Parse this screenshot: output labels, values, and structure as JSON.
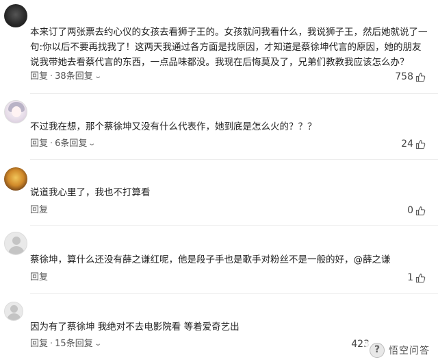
{
  "comments": [
    {
      "text": "本来订了两张票去约心仪的女孩去看狮子王的。女孩就问我看什么，我说狮子王，然后她就说了一句:你以后不要再找我了！这两天我通过各方面是找原因，才知道是蔡徐坤代言的原因，她的朋友说我带她去看蔡代言的东西，一点品味都没。我现在后悔莫及了，兄弟们教教我应该怎么办？",
      "reply_label": "回复",
      "sep": "·",
      "replies_label": "38条回复",
      "likes": "758",
      "avatar": "dark"
    },
    {
      "text": "不过我在想，那个蔡徐坤又没有什么代表作，她到底是怎么火的？？？",
      "reply_label": "回复",
      "sep": "·",
      "replies_label": "6条回复",
      "likes": "24",
      "avatar": "anime"
    },
    {
      "text": "说道我心里了，我也不打算看",
      "reply_label": "回复",
      "likes": "0",
      "avatar": "pizza"
    },
    {
      "text": "蔡徐坤，算什么还没有薛之谦红呢，他是段子手也是歌手对粉丝不是一般的好，@薛之谦",
      "reply_label": "回复",
      "likes": "1",
      "avatar": "gray"
    },
    {
      "text": "因为有了蔡徐坤 我绝对不去电影院看 等着爱奇艺出",
      "reply_label": "回复",
      "sep": "·",
      "replies_label": "15条回复",
      "likes": "423",
      "avatar": "gray"
    }
  ],
  "watermark": {
    "text": "悟空问答",
    "icon": "wukong-logo-icon"
  },
  "colors": {
    "text": "#222222",
    "meta": "#555555",
    "divider": "#ececec"
  },
  "icons": {
    "like": "thumbs-up-icon",
    "expand": "chevron-down-icon"
  }
}
